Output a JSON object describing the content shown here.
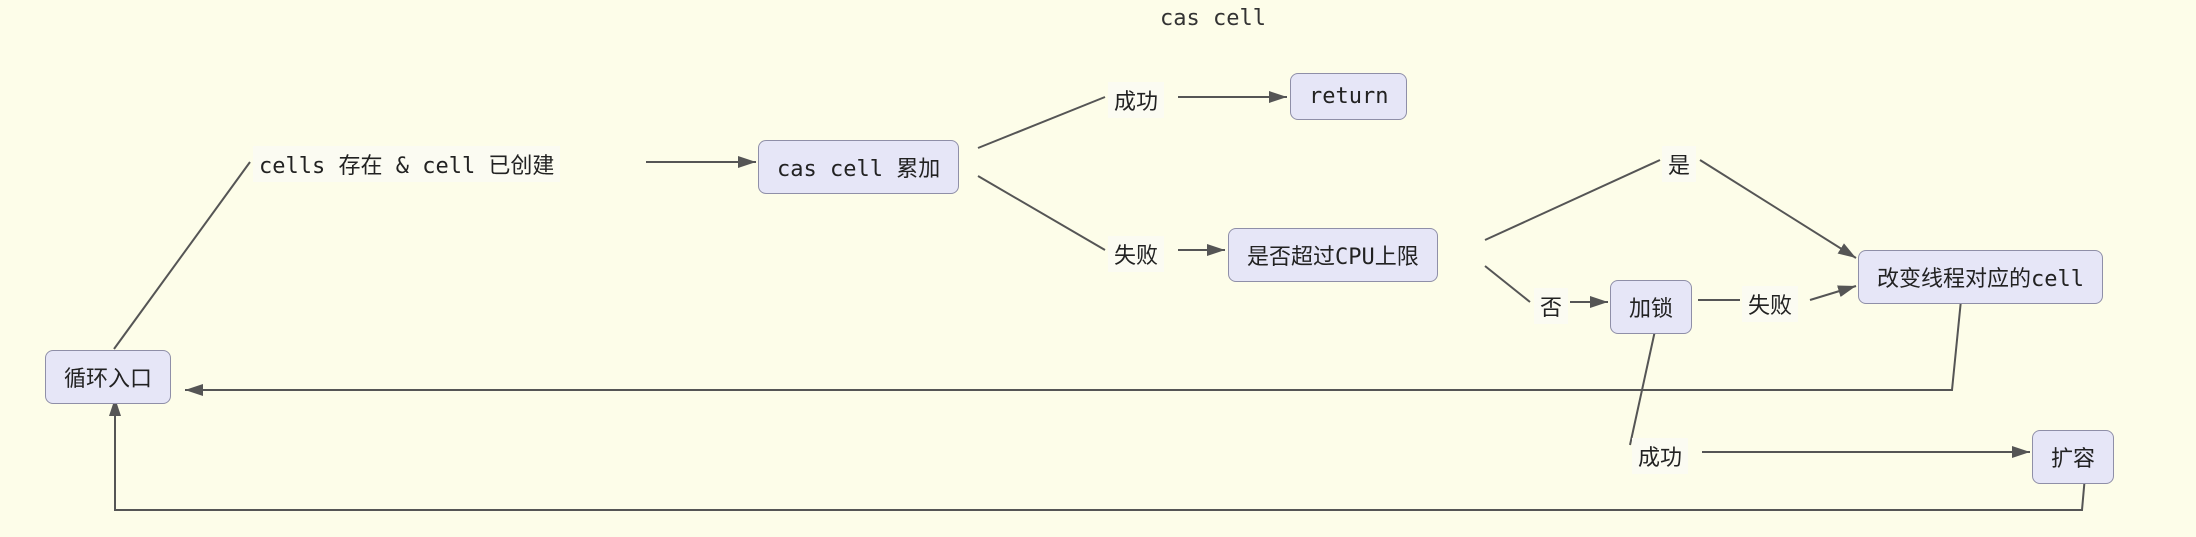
{
  "diagram": {
    "title": "cas cell",
    "nodes": {
      "loop_entry": "循环入口",
      "cas_cell_add": "cas cell 累加",
      "return": "return",
      "cpu_limit": "是否超过CPU上限",
      "lock": "加锁",
      "change_cell": "改变线程对应的cell",
      "expand": "扩容"
    },
    "edges": {
      "cells_exists": "cells 存在 & cell 已创建",
      "success": "成功",
      "fail": "失败",
      "yes": "是",
      "no": "否",
      "lock_success": "成功",
      "lock_fail": "失败"
    }
  }
}
